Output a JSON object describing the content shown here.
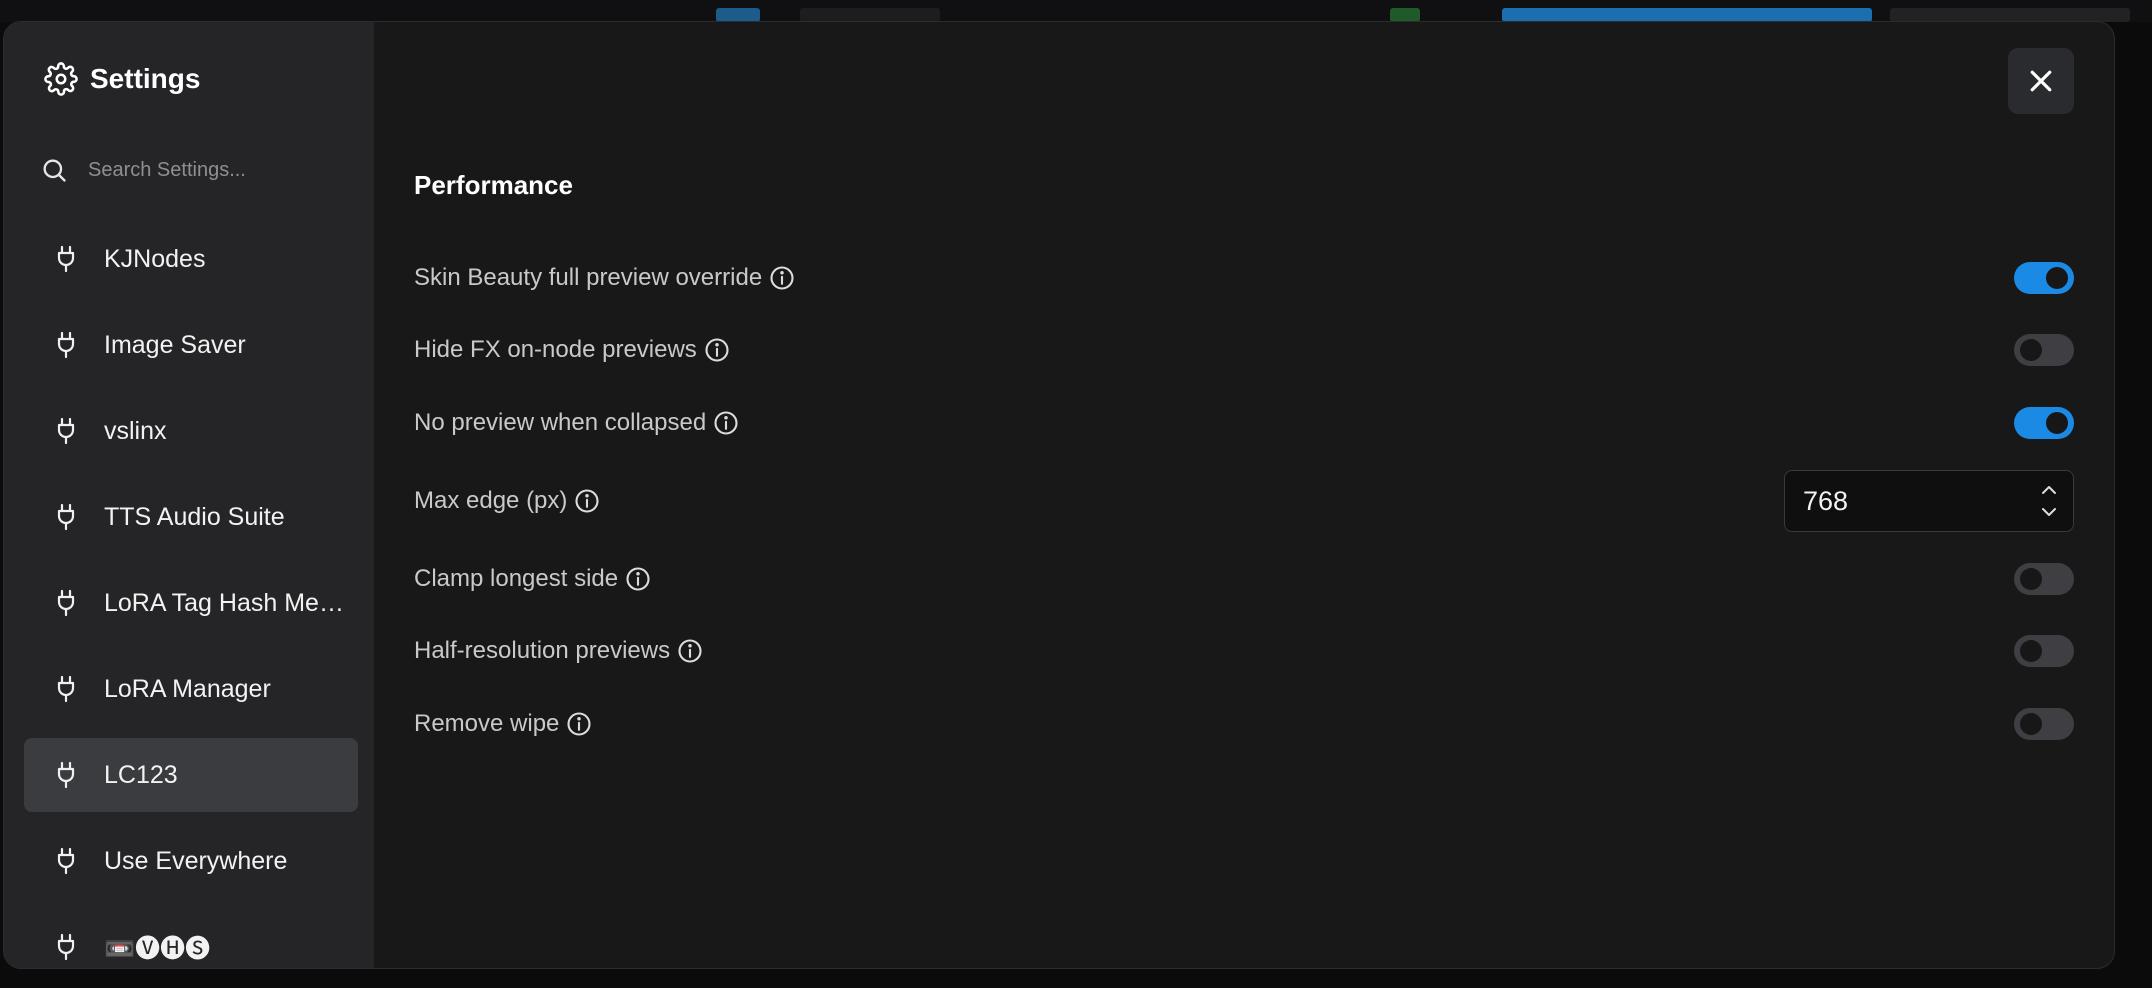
{
  "settings": {
    "title": "Settings",
    "search_placeholder": "Search Settings...",
    "sidebar_items": [
      {
        "label": "KJNodes",
        "active": false
      },
      {
        "label": "Image Saver",
        "active": false
      },
      {
        "label": "vslinx",
        "active": false
      },
      {
        "label": "TTS Audio Suite",
        "active": false
      },
      {
        "label": "LoRA Tag Hash Met...",
        "active": false
      },
      {
        "label": "LoRA Manager",
        "active": false
      },
      {
        "label": "LC123",
        "active": true
      },
      {
        "label": "Use Everywhere",
        "active": false
      },
      {
        "label": "📼🅥🅗🅢",
        "active": false
      }
    ]
  },
  "panel": {
    "section_title": "Performance",
    "rows": [
      {
        "label": "Skin Beauty full preview override",
        "type": "toggle",
        "on": true
      },
      {
        "label": "Hide FX on-node previews",
        "type": "toggle",
        "on": false
      },
      {
        "label": "No preview when collapsed",
        "type": "toggle",
        "on": true
      },
      {
        "label": "Max edge (px)",
        "type": "number",
        "value": "768"
      },
      {
        "label": "Clamp longest side",
        "type": "toggle",
        "on": false
      },
      {
        "label": "Half-resolution previews",
        "type": "toggle",
        "on": false
      },
      {
        "label": "Remove wipe",
        "type": "toggle",
        "on": false
      }
    ]
  },
  "icons": {
    "settings": "gear-icon",
    "search": "search-icon",
    "sidebar_item": "plug-icon",
    "close": "close-icon",
    "info": "info-icon",
    "increment": "chevron-up-icon",
    "decrement": "chevron-down-icon"
  },
  "colors": {
    "accent": "#1a8ae5",
    "modal_bg": "#181818",
    "sidebar_bg": "#252527",
    "active_item_bg": "#3b3c40"
  }
}
